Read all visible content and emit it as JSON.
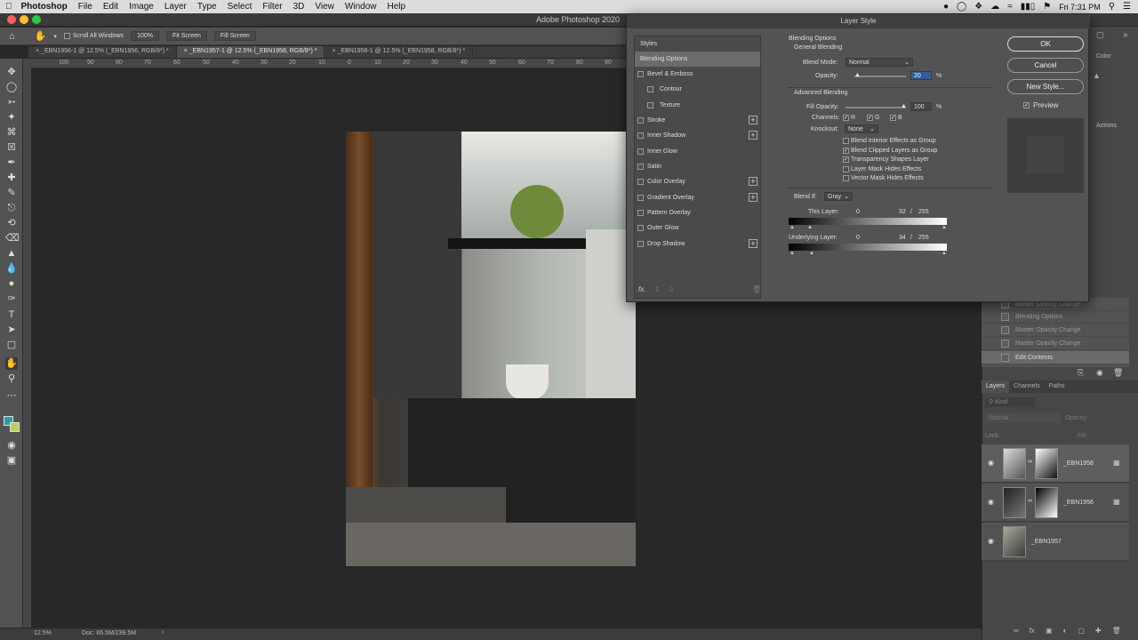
{
  "menubar": {
    "app": "Photoshop",
    "items": [
      "File",
      "Edit",
      "Image",
      "Layer",
      "Type",
      "Select",
      "Filter",
      "3D",
      "View",
      "Window",
      "Help"
    ],
    "clock": "Fri 7:31 PM"
  },
  "window": {
    "title": "Adobe Photoshop 2020"
  },
  "options": {
    "scroll_all": "Scroll All Windows",
    "zoom_100": "100%",
    "fit_screen": "Fit Screen",
    "fill_screen": "Fill Screen"
  },
  "tabs": [
    {
      "label": "_EBN1956-1 @ 12.5% (_EBN1956, RGB/8*) *"
    },
    {
      "label": "_EBN1957-1 @ 12.5% (_EBN1958, RGB/8*) *"
    },
    {
      "label": "_EBN1958-1 @ 12.5% (_EBN1958, RGB/8*) *"
    }
  ],
  "ruler": [
    "100",
    "90",
    "80",
    "70",
    "60",
    "50",
    "40",
    "30",
    "20",
    "10",
    "0",
    "10",
    "20",
    "30",
    "40",
    "50",
    "60",
    "70",
    "80",
    "90"
  ],
  "status": {
    "zoom": "12.5%",
    "doc": "Doc: 65.5M/239.5M"
  },
  "history": [
    {
      "label": "Master Opacity Change"
    },
    {
      "label": "Blending Options"
    },
    {
      "label": "Master Opacity Change"
    },
    {
      "label": "Master Opacity Change"
    },
    {
      "label": "Edit Contents"
    }
  ],
  "panel_tabs": {
    "layers": "Layers",
    "channels": "Channels",
    "paths": "Paths",
    "color": "Color",
    "actions": "Actions"
  },
  "layers": [
    {
      "name": "_EBN1958"
    },
    {
      "name": "_EBN1956"
    },
    {
      "name": "_EBN1957"
    }
  ],
  "layers_controls": {
    "kind": "Kind",
    "mode": "Normal",
    "opacity": "Opacity:",
    "lock": "Lock:",
    "fill": "Fill:"
  },
  "dialog": {
    "title": "Layer Style",
    "styles_header": "Styles",
    "styles": [
      {
        "label": "Blending Options"
      },
      {
        "label": "Bevel & Emboss"
      },
      {
        "label": "Contour"
      },
      {
        "label": "Texture"
      },
      {
        "label": "Stroke"
      },
      {
        "label": "Inner Shadow"
      },
      {
        "label": "Inner Glow"
      },
      {
        "label": "Satin"
      },
      {
        "label": "Color Overlay"
      },
      {
        "label": "Gradient Overlay"
      },
      {
        "label": "Pattern Overlay"
      },
      {
        "label": "Outer Glow"
      },
      {
        "label": "Drop Shadow"
      }
    ],
    "fx": "fx.",
    "blending_options": "Blending Options",
    "general_blending": "General Blending",
    "blend_mode_label": "Blend Mode:",
    "blend_mode": "Normal",
    "opacity_label": "Opacity:",
    "opacity": "20",
    "percent": "%",
    "advanced_blending": "Advanced Blending",
    "fill_opacity_label": "Fill Opacity:",
    "fill_opacity": "100",
    "channels_label": "Channels:",
    "ch_r": "R",
    "ch_g": "G",
    "ch_b": "B",
    "knockout_label": "Knockout:",
    "knockout": "None",
    "options": [
      {
        "label": "Blend Interior Effects as Group",
        "checked": false
      },
      {
        "label": "Blend Clipped Layers as Group",
        "checked": true
      },
      {
        "label": "Transparency Shapes Layer",
        "checked": true
      },
      {
        "label": "Layer Mask Hides Effects",
        "checked": false
      },
      {
        "label": "Vector Mask Hides Effects",
        "checked": false
      }
    ],
    "blend_if_label": "Blend If:",
    "blend_if": "Gray",
    "this_layer_label": "This Layer:",
    "this_layer_low": "0",
    "this_layer_high": "32",
    "this_layer_max": "255",
    "underlying_label": "Underlying Layer:",
    "underlying_low": "0",
    "underlying_high": "34",
    "underlying_max": "255",
    "slash": "/",
    "ok": "OK",
    "cancel": "Cancel",
    "new_style": "New Style...",
    "preview": "Preview"
  }
}
